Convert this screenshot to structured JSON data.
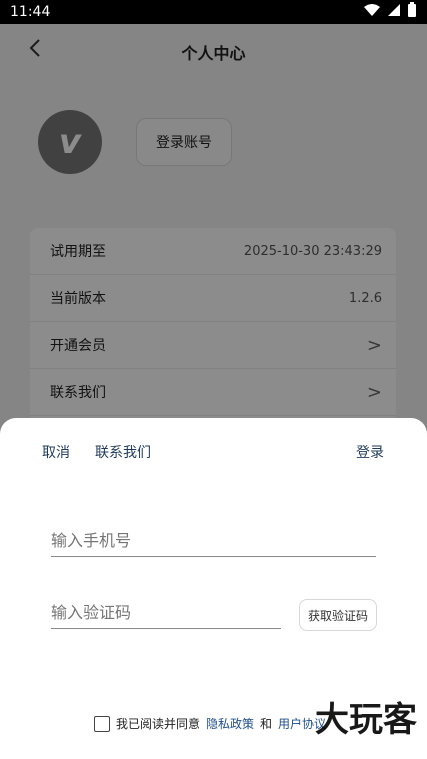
{
  "status": {
    "time": "11:44"
  },
  "header": {
    "title": "个人中心"
  },
  "profile": {
    "login_button": "登录账号"
  },
  "rows": [
    {
      "label": "试用期至",
      "value": "2025-10-30 23:43:29"
    },
    {
      "label": "当前版本",
      "value": "1.2.6"
    },
    {
      "label": "开通会员",
      "value": ">"
    },
    {
      "label": "联系我们",
      "value": ">"
    }
  ],
  "sheet": {
    "cancel": "取消",
    "contact": "联系我们",
    "login": "登录",
    "phone_placeholder": "输入手机号",
    "code_placeholder": "输入验证码",
    "get_code": "获取验证码",
    "agree_prefix": "我已阅读并同意",
    "privacy": "隐私政策",
    "and": "和",
    "user_agreement": "用户协议"
  },
  "watermark": "大玩客"
}
